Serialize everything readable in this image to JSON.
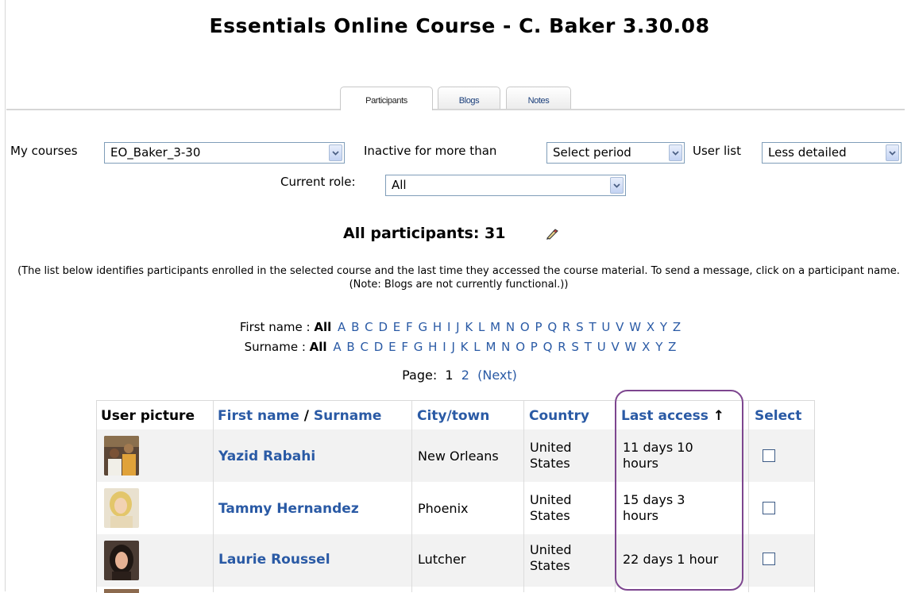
{
  "page_title": "Essentials Online Course - C. Baker 3.30.08",
  "tabs": [
    {
      "label": "Participants",
      "active": true
    },
    {
      "label": "Blogs",
      "active": false
    },
    {
      "label": "Notes",
      "active": false
    }
  ],
  "filters": {
    "my_courses_label": "My courses",
    "my_courses_value": "EO_Baker_3-30",
    "inactive_label": "Inactive for more than",
    "inactive_value": "Select period",
    "user_list_label": "User list",
    "user_list_value": "Less detailed",
    "current_role_label": "Current role:",
    "current_role_value": "All"
  },
  "participants_heading": "All participants: 31",
  "info_text": "(The list below identifies participants enrolled in the selected course and the last time they accessed the course material. To send a message, click on a participant name. (Note: Blogs are not currently functional.))",
  "alphabet_filter": {
    "first_name_label": "First name :",
    "surname_label": "Surname :",
    "all_label": "All",
    "letters": [
      "A",
      "B",
      "C",
      "D",
      "E",
      "F",
      "G",
      "H",
      "I",
      "J",
      "K",
      "L",
      "M",
      "N",
      "O",
      "P",
      "Q",
      "R",
      "S",
      "T",
      "U",
      "V",
      "W",
      "X",
      "Y",
      "Z"
    ]
  },
  "pagination": {
    "label": "Page:",
    "current": "1",
    "next_page": "2",
    "next_label": "(Next)"
  },
  "table": {
    "headers": {
      "user_picture": "User picture",
      "first_name": "First name",
      "separator": "/",
      "surname": "Surname",
      "city": "City/town",
      "country": "Country",
      "last_access": "Last access",
      "sort_arrow": "↑",
      "select": "Select"
    },
    "rows": [
      {
        "name": "Yazid Rabahi",
        "city": "New Orleans",
        "country_line1": "United",
        "country_line2": "States",
        "last_access_line1": "11 days 10",
        "last_access_line2": "hours"
      },
      {
        "name": "Tammy Hernandez",
        "city": "Phoenix",
        "country_line1": "United",
        "country_line2": "States",
        "last_access_line1": "15 days 3",
        "last_access_line2": "hours"
      },
      {
        "name": "Laurie Roussel",
        "city": "Lutcher",
        "country_line1": "United",
        "country_line2": "States",
        "last_access_line1": "22 days 1 hour",
        "last_access_line2": ""
      }
    ]
  },
  "colors": {
    "link": "#2a5aa5",
    "highlight_outline": "#7d468f",
    "alt_row": "#f2f2f2"
  }
}
